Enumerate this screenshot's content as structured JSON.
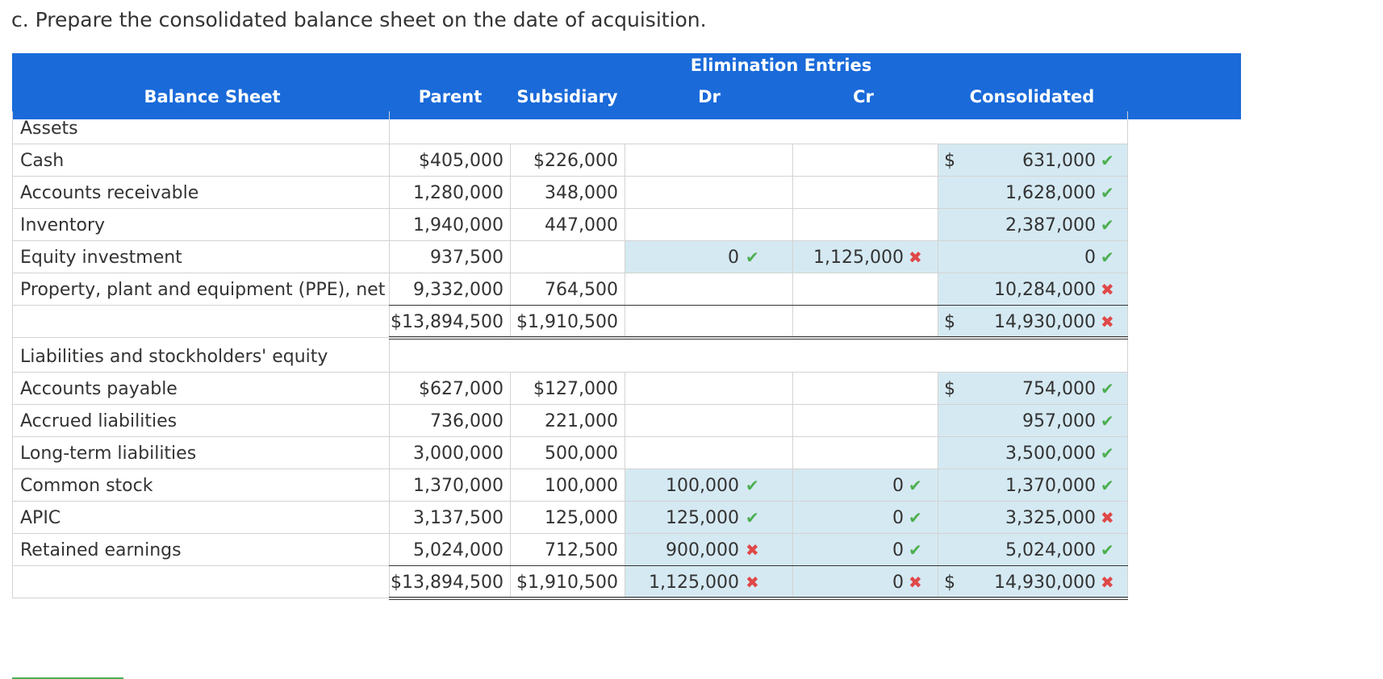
{
  "title": "c. Prepare the consolidated balance sheet on the date of acquisition.",
  "header": {
    "balance_sheet": "Balance Sheet",
    "parent": "Parent",
    "subsidiary": "Subsidiary",
    "elimination_entries": "Elimination Entries",
    "dr": "Dr",
    "cr": "Cr",
    "consolidated": "Consolidated"
  },
  "sections": {
    "assets": "Assets",
    "liabilities": "Liabilities and stockholders' equity"
  },
  "colors": {
    "header_bg": "#1a6ad9",
    "input_bg": "#d5e9f2",
    "check": "#4caf50",
    "cross": "#e04848"
  },
  "rows": [
    {
      "label": "Cash",
      "parent": "$405,000",
      "subsidiary": "$226,000",
      "dr": "",
      "cr": "",
      "dollar": "$",
      "consolidated": "631,000",
      "dr_mark": "",
      "cr_mark": "",
      "con_mark": "check"
    },
    {
      "label": "Accounts receivable",
      "parent": "1,280,000",
      "subsidiary": "348,000",
      "dr": "",
      "cr": "",
      "dollar": "",
      "consolidated": "1,628,000",
      "dr_mark": "",
      "cr_mark": "",
      "con_mark": "check"
    },
    {
      "label": "Inventory",
      "parent": "1,940,000",
      "subsidiary": "447,000",
      "dr": "",
      "cr": "",
      "dollar": "",
      "consolidated": "2,387,000",
      "dr_mark": "",
      "cr_mark": "",
      "con_mark": "check"
    },
    {
      "label": "Equity investment",
      "parent": "937,500",
      "subsidiary": "",
      "dr": "0",
      "cr": "1,125,000",
      "dollar": "",
      "consolidated": "0",
      "dr_mark": "check",
      "cr_mark": "cross",
      "con_mark": "check"
    },
    {
      "label": "Property, plant and equipment (PPE), net",
      "parent": "9,332,000",
      "subsidiary": "764,500",
      "dr": "",
      "cr": "",
      "dollar": "",
      "consolidated": "10,284,000",
      "dr_mark": "",
      "cr_mark": "",
      "con_mark": "cross"
    },
    {
      "label": "",
      "parent": "$13,894,500",
      "subsidiary": "$1,910,500",
      "dr": "",
      "cr": "",
      "dollar": "$",
      "consolidated": "14,930,000",
      "dr_mark": "",
      "cr_mark": "",
      "con_mark": "cross"
    },
    {
      "label": "Accounts payable",
      "parent": "$627,000",
      "subsidiary": "$127,000",
      "dr": "",
      "cr": "",
      "dollar": "$",
      "consolidated": "754,000",
      "dr_mark": "",
      "cr_mark": "",
      "con_mark": "check"
    },
    {
      "label": "Accrued liabilities",
      "parent": "736,000",
      "subsidiary": "221,000",
      "dr": "",
      "cr": "",
      "dollar": "",
      "consolidated": "957,000",
      "dr_mark": "",
      "cr_mark": "",
      "con_mark": "check"
    },
    {
      "label": "Long-term liabilities",
      "parent": "3,000,000",
      "subsidiary": "500,000",
      "dr": "",
      "cr": "",
      "dollar": "",
      "consolidated": "3,500,000",
      "dr_mark": "",
      "cr_mark": "",
      "con_mark": "check"
    },
    {
      "label": "Common stock",
      "parent": "1,370,000",
      "subsidiary": "100,000",
      "dr": "100,000",
      "cr": "0",
      "dollar": "",
      "consolidated": "1,370,000",
      "dr_mark": "check",
      "cr_mark": "check",
      "con_mark": "check"
    },
    {
      "label": "APIC",
      "parent": "3,137,500",
      "subsidiary": "125,000",
      "dr": "125,000",
      "cr": "0",
      "dollar": "",
      "consolidated": "3,325,000",
      "dr_mark": "check",
      "cr_mark": "check",
      "con_mark": "cross"
    },
    {
      "label": "Retained earnings",
      "parent": "5,024,000",
      "subsidiary": "712,500",
      "dr": "900,000",
      "cr": "0",
      "dollar": "",
      "consolidated": "5,024,000",
      "dr_mark": "cross",
      "cr_mark": "check",
      "con_mark": "check"
    },
    {
      "label": "",
      "parent": "$13,894,500",
      "subsidiary": "$1,910,500",
      "dr": "1,125,000",
      "cr": "0",
      "dollar": "$",
      "consolidated": "14,930,000",
      "dr_mark": "cross",
      "cr_mark": "cross",
      "con_mark": "cross"
    }
  ]
}
